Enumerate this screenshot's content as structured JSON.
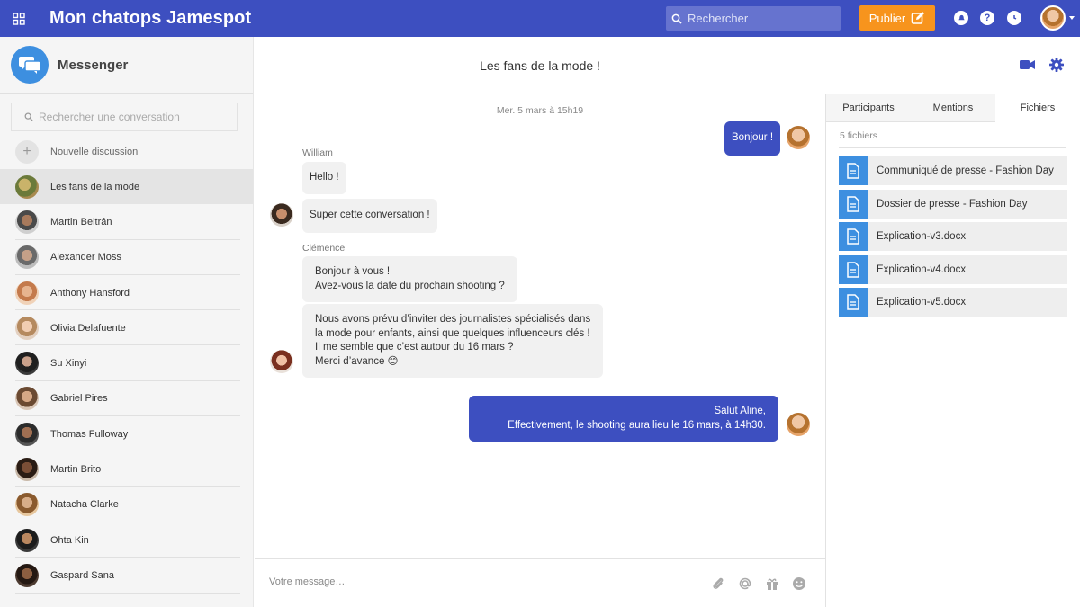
{
  "topbar": {
    "title": "Mon chatops Jamespot",
    "search_placeholder": "Rechercher",
    "publish_label": "Publier"
  },
  "sidebar": {
    "title": "Messenger",
    "search_placeholder": "Rechercher une conversation",
    "new_discussion": "Nouvelle discussion",
    "conversations": [
      {
        "name": "Les fans de la mode",
        "active": true
      },
      {
        "name": "Martin Beltrán"
      },
      {
        "name": "Alexander Moss"
      },
      {
        "name": "Anthony Hansford"
      },
      {
        "name": "Olivia Delafuente"
      },
      {
        "name": "Su Xinyi"
      },
      {
        "name": "Gabriel Pires"
      },
      {
        "name": "Thomas Fulloway"
      },
      {
        "name": "Martin Brito"
      },
      {
        "name": "Natacha Clarke"
      },
      {
        "name": "Ohta Kin"
      },
      {
        "name": "Gaspard Sana"
      }
    ]
  },
  "conversation": {
    "title": "Les fans de la mode !",
    "date": "Mer. 5 mars à 15h19",
    "messages": {
      "m1": "Bonjour !",
      "william_name": "William",
      "m2": "Hello !",
      "m3": "Super cette conversation !",
      "clemence_name": "Clémence",
      "m4_l1": "Bonjour à vous !",
      "m4_l2": "Avez-vous la date du prochain shooting ?",
      "m5_l1": "Nous avons prévu d’inviter des journalistes spécialisés dans",
      "m5_l2": "la mode pour enfants, ainsi que quelques influenceurs clés !",
      "m5_l3": "Il me semble que c’est autour du 16 mars ?",
      "m5_l4": "Merci d’avance 😊",
      "m6_l1": "Salut Aline,",
      "m6_l2": "Effectivement, le shooting aura lieu le 16 mars, à 14h30."
    },
    "composer_placeholder": "Votre message…"
  },
  "right_panel": {
    "tabs": [
      "Participants",
      "Mentions",
      "Fichiers"
    ],
    "active_tab": "Fichiers",
    "files_count": "5 fichiers",
    "files": [
      "Communiqué de presse - Fashion Day",
      "Dossier de presse - Fashion Day",
      "Explication-v3.docx",
      "Explication-v4.docx",
      "Explication-v5.docx"
    ]
  },
  "colors": {
    "brand": "#3d4fc0",
    "accent": "#f7941d",
    "file_blue": "#3d8fe0"
  }
}
